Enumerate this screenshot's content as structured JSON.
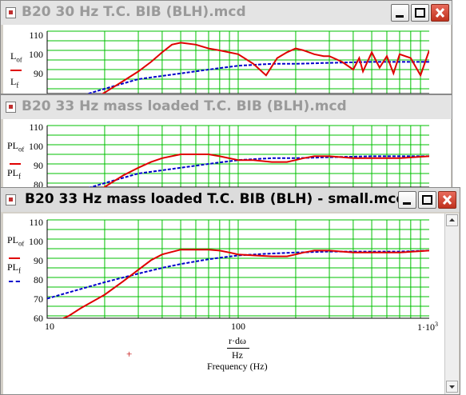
{
  "windows": [
    {
      "title": "B20 30 Hz T.C. BIB (BLH).mcd",
      "yticks": [
        "110",
        "100",
        "90"
      ],
      "legend_top": "L",
      "legend_top_sub": "o",
      "legend_top_sub2": "f",
      "legend_bottom": "L",
      "legend_bottom_sub": "f"
    },
    {
      "title": "B20 33 Hz mass loaded T.C. BIB (BLH).mcd",
      "yticks": [
        "110",
        "100",
        "90",
        "80"
      ],
      "legend_top": "PL",
      "legend_top_sub": "o",
      "legend_top_sub2": "f",
      "legend_bottom": "PL",
      "legend_bottom_sub": "f"
    },
    {
      "title": "B20 33 Hz mass loaded T.C. BIB (BLH) - small.mcd",
      "yticks": [
        "110",
        "100",
        "90",
        "80",
        "70",
        "60"
      ],
      "xticks": [
        "10",
        "100",
        "1·10"
      ],
      "xtick_exp": "3",
      "legend_top": "PL",
      "legend_top_sub": "o",
      "legend_top_sub2": "f",
      "legend_bottom": "PL",
      "legend_bottom_sub": "f",
      "xexpr_num": "r·dω",
      "xexpr_den": "Hz",
      "xlabel": "Frequency (Hz)",
      "plus_marker": "+"
    }
  ],
  "colors": {
    "red": "#e00000",
    "blue": "#0000cc",
    "grid": "#00c000"
  },
  "chart_data": [
    {
      "type": "line",
      "title": "",
      "xlabel": "",
      "ylabel": "",
      "x_scale": "log",
      "xlim": [
        10,
        1000
      ],
      "ylim": [
        80,
        110
      ],
      "series": [
        {
          "color": "#e00000",
          "style": "solid",
          "x": [
            10,
            15,
            20,
            25,
            30,
            35,
            40,
            45,
            50,
            60,
            70,
            80,
            100,
            120,
            140,
            160,
            180,
            200,
            220,
            250,
            280,
            300,
            350,
            400,
            430,
            450,
            500,
            550,
            600,
            650,
            700,
            800,
            900,
            1000
          ],
          "y": [
            60,
            71,
            78,
            84,
            89,
            94,
            99,
            103,
            104,
            103,
            101,
            100,
            98,
            93,
            87,
            96,
            99,
            101,
            100,
            98,
            97,
            97,
            94,
            90,
            96,
            89,
            99,
            91,
            97,
            88,
            98,
            96,
            87,
            100
          ]
        },
        {
          "color": "#0000cc",
          "style": "dashed",
          "x": [
            10,
            20,
            30,
            50,
            70,
            100,
            150,
            200,
            300,
            500,
            700,
            1000
          ],
          "y": [
            71,
            80,
            85,
            88,
            90,
            92,
            93,
            93,
            93.5,
            94,
            94,
            94
          ]
        }
      ]
    },
    {
      "type": "line",
      "title": "",
      "xlabel": "",
      "ylabel": "",
      "x_scale": "log",
      "xlim": [
        10,
        1000
      ],
      "ylim": [
        76,
        110
      ],
      "series": [
        {
          "color": "#e00000",
          "style": "solid",
          "x": [
            10,
            15,
            20,
            25,
            30,
            35,
            40,
            50,
            60,
            70,
            80,
            100,
            120,
            150,
            180,
            200,
            220,
            250,
            300,
            400,
            500,
            700,
            1000
          ],
          "y": [
            60,
            71,
            78,
            84,
            88,
            91,
            93,
            95,
            95,
            95,
            94,
            92,
            92,
            91,
            91,
            92,
            93,
            94,
            94,
            93,
            93,
            93,
            94
          ]
        },
        {
          "color": "#0000cc",
          "style": "dashed",
          "x": [
            10,
            20,
            30,
            50,
            70,
            100,
            150,
            200,
            300,
            500,
            700,
            1000
          ],
          "y": [
            71,
            80,
            85,
            88,
            90,
            92,
            93,
            93,
            93.5,
            94,
            94,
            94
          ]
        }
      ]
    },
    {
      "type": "line",
      "title": "",
      "xlabel": "Frequency (Hz)",
      "ylabel": "",
      "x_scale": "log",
      "xlim": [
        10,
        1000
      ],
      "ylim": [
        60,
        110
      ],
      "series": [
        {
          "color": "#e00000",
          "style": "solid",
          "x": [
            10,
            13,
            15,
            20,
            25,
            30,
            35,
            40,
            50,
            60,
            70,
            80,
            90,
            100,
            120,
            150,
            180,
            200,
            220,
            250,
            300,
            400,
            500,
            700,
            1000
          ],
          "y": [
            55,
            60,
            64,
            71,
            78,
            84,
            89,
            92,
            94.5,
            94.5,
            94.5,
            94,
            93,
            92,
            91.5,
            91,
            91,
            92,
            93,
            94,
            94,
            93,
            93,
            93,
            94
          ]
        },
        {
          "color": "#0000cc",
          "style": "dashed",
          "x": [
            10,
            15,
            20,
            30,
            40,
            50,
            70,
            100,
            150,
            200,
            300,
            500,
            700,
            1000
          ],
          "y": [
            69,
            74,
            77.5,
            82,
            85,
            87,
            89.5,
            91.5,
            92.5,
            93,
            93.5,
            93.5,
            93.5,
            94
          ]
        }
      ]
    }
  ]
}
